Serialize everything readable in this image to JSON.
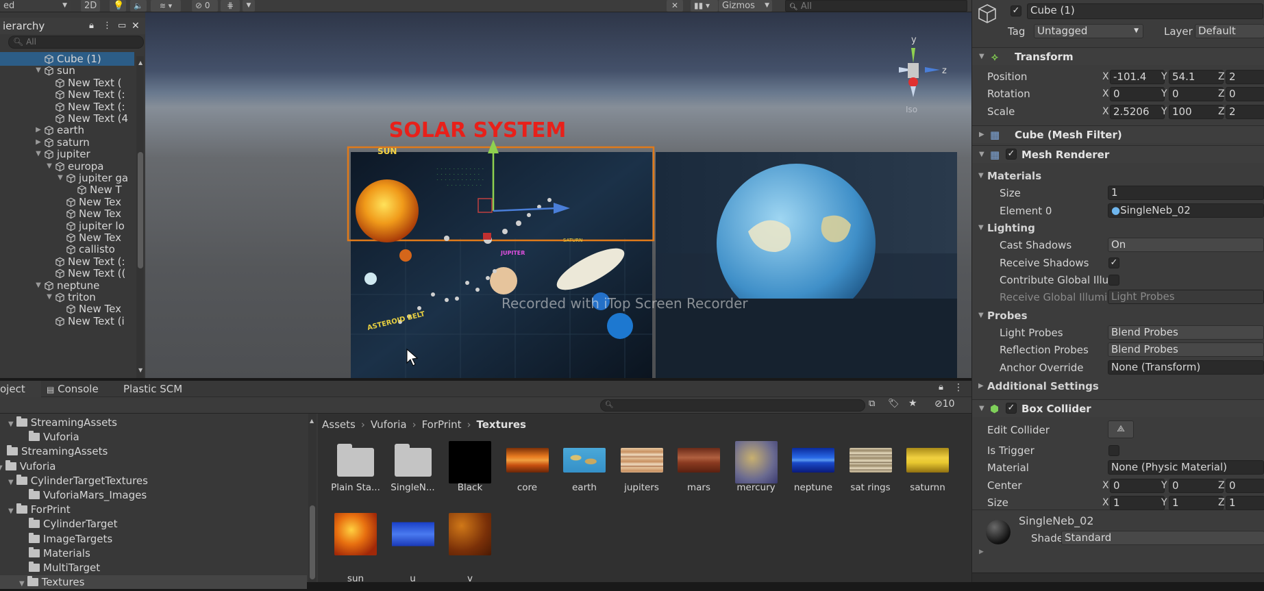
{
  "toolbar": {
    "mode_text": "ed",
    "view_2d": "2D",
    "hidden_count": "0",
    "search_placeholder": "All",
    "gizmos_label": "Gizmos"
  },
  "hierarchy": {
    "title": "ierarchy",
    "search_placeholder": "All",
    "items": [
      {
        "label": "Cube (1)",
        "depth": 0,
        "arrow": "none",
        "selected": true
      },
      {
        "label": "sun",
        "depth": 0,
        "arrow": "down"
      },
      {
        "label": "New Text (",
        "depth": 1,
        "arrow": "none"
      },
      {
        "label": "New Text (:",
        "depth": 1,
        "arrow": "none"
      },
      {
        "label": "New Text (:",
        "depth": 1,
        "arrow": "none"
      },
      {
        "label": "New Text (4",
        "depth": 1,
        "arrow": "none"
      },
      {
        "label": "earth",
        "depth": 0,
        "arrow": "right"
      },
      {
        "label": "saturn",
        "depth": 0,
        "arrow": "right"
      },
      {
        "label": "jupiter",
        "depth": 0,
        "arrow": "down"
      },
      {
        "label": "europa",
        "depth": 1,
        "arrow": "down"
      },
      {
        "label": "jupiter ga",
        "depth": 2,
        "arrow": "down"
      },
      {
        "label": "New T",
        "depth": 3,
        "arrow": "none"
      },
      {
        "label": "New Tex",
        "depth": 2,
        "arrow": "none"
      },
      {
        "label": "New Tex",
        "depth": 2,
        "arrow": "none"
      },
      {
        "label": "jupiter lo",
        "depth": 2,
        "arrow": "none"
      },
      {
        "label": "New Tex",
        "depth": 2,
        "arrow": "none"
      },
      {
        "label": "callisto",
        "depth": 2,
        "arrow": "none"
      },
      {
        "label": "New Text (:",
        "depth": 1,
        "arrow": "none"
      },
      {
        "label": "New Text ((",
        "depth": 1,
        "arrow": "none"
      },
      {
        "label": "neptune",
        "depth": 0,
        "arrow": "down"
      },
      {
        "label": "triton",
        "depth": 1,
        "arrow": "down"
      },
      {
        "label": "New Tex",
        "depth": 2,
        "arrow": "none"
      },
      {
        "label": "New Text (i",
        "depth": 1,
        "arrow": "none"
      }
    ]
  },
  "scene": {
    "title": "SOLAR  SYSTEM",
    "sun_label": "SUN",
    "jupiter_label": "JUPITER",
    "saturn_label": "SATURN",
    "asteroid_label": "ASTEROID BELT",
    "watermark": "Recorded with iTop Screen Recorder",
    "gizmo_y": "y",
    "gizmo_z": "z",
    "gizmo_persp": "Iso"
  },
  "project": {
    "tabs": [
      "oject",
      "Console",
      "Plastic SCM"
    ],
    "hidden_count": "10",
    "breadcrumb": [
      "Assets",
      "Vuforia",
      "ForPrint",
      "Textures"
    ],
    "tree": [
      {
        "label": "StreamingAssets",
        "indent": 1,
        "arrow": "down"
      },
      {
        "label": "Vuforia",
        "indent": 2,
        "arrow": "none"
      },
      {
        "label": "StreamingAssets",
        "indent": 0,
        "arrow": "none"
      },
      {
        "label": "Vuforia",
        "indent": 0,
        "arrow": "down"
      },
      {
        "label": "CylinderTargetTextures",
        "indent": 1,
        "arrow": "down"
      },
      {
        "label": "VuforiaMars_Images",
        "indent": 2,
        "arrow": "none"
      },
      {
        "label": "ForPrint",
        "indent": 1,
        "arrow": "down"
      },
      {
        "label": "CylinderTarget",
        "indent": 2,
        "arrow": "none"
      },
      {
        "label": "ImageTargets",
        "indent": 2,
        "arrow": "none"
      },
      {
        "label": "Materials",
        "indent": 2,
        "arrow": "none"
      },
      {
        "label": "MultiTarget",
        "indent": 2,
        "arrow": "none"
      },
      {
        "label": "Textures",
        "indent": 2,
        "arrow": "down",
        "selected": true
      }
    ],
    "assets": [
      {
        "label": "Plain Sta...",
        "kind": "folder"
      },
      {
        "label": "SingleN...",
        "kind": "folder"
      },
      {
        "label": "Black",
        "kind": "black"
      },
      {
        "label": "core",
        "kind": "core"
      },
      {
        "label": "earth",
        "kind": "earth"
      },
      {
        "label": "jupiters",
        "kind": "jupiter"
      },
      {
        "label": "mars",
        "kind": "mars"
      },
      {
        "label": "mercury",
        "kind": "mercury"
      },
      {
        "label": "neptune",
        "kind": "neptune"
      },
      {
        "label": "sat rings",
        "kind": "satrings"
      },
      {
        "label": "saturnn",
        "kind": "saturn"
      },
      {
        "label": "sun",
        "kind": "sun"
      },
      {
        "label": "u",
        "kind": "u"
      },
      {
        "label": "v",
        "kind": "v"
      }
    ]
  },
  "inspector": {
    "object_name": "Cube (1)",
    "tag_label": "Tag",
    "tag_value": "Untagged",
    "layer_label": "Layer",
    "layer_value": "Default",
    "transform": {
      "title": "Transform",
      "position_label": "Position",
      "rotation_label": "Rotation",
      "scale_label": "Scale",
      "position": [
        "-101.4",
        "54.1",
        "2"
      ],
      "rotation": [
        "0",
        "0",
        "0"
      ],
      "scale": [
        "2.5206",
        "100",
        "2"
      ]
    },
    "mesh_filter_title": "Cube (Mesh Filter)",
    "mesh_renderer": {
      "title": "Mesh Renderer",
      "materials_label": "Materials",
      "size_label": "Size",
      "size_value": "1",
      "element0_label": "Element 0",
      "element0_value": "SingleNeb_02",
      "lighting_label": "Lighting",
      "cast_shadows_label": "Cast Shadows",
      "cast_shadows_value": "On",
      "receive_shadows_label": "Receive Shadows",
      "contribute_gi_label": "Contribute Global Illu",
      "receive_gi_label": "Receive Global Illumi",
      "receive_gi_value": "Light Probes",
      "probes_label": "Probes",
      "light_probes_label": "Light Probes",
      "light_probes_value": "Blend Probes",
      "reflection_probes_label": "Reflection Probes",
      "reflection_probes_value": "Blend Probes",
      "anchor_override_label": "Anchor Override",
      "anchor_override_value": "None (Transform)",
      "additional_settings_label": "Additional Settings"
    },
    "box_collider": {
      "title": "Box Collider",
      "edit_collider_label": "Edit Collider",
      "is_trigger_label": "Is Trigger",
      "material_label": "Material",
      "material_value": "None (Physic Material)",
      "center_label": "Center",
      "center": [
        "0",
        "0",
        "0"
      ],
      "size_label": "Size",
      "size": [
        "1",
        "1",
        "1"
      ]
    },
    "material": {
      "name": "SingleNeb_02",
      "shader_label": "Shader",
      "shader_value": "Standard"
    },
    "axis_letters": [
      "X",
      "Y",
      "Z"
    ]
  }
}
